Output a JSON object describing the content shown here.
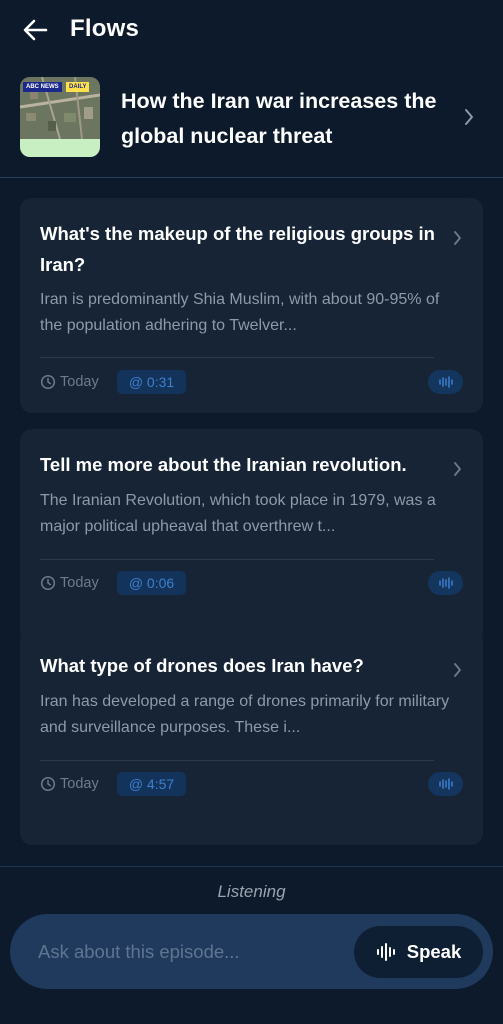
{
  "header": {
    "title": "Flows"
  },
  "episode": {
    "title": "How the Iran war increases the global nuclear threat",
    "thumbnail": {
      "brand": "ABC NEWS",
      "show": "DAILY"
    }
  },
  "cards": [
    {
      "question": "What's the makeup of the religious groups in Iran?",
      "answer": "Iran is predominantly Shia Muslim, with about 90-95% of the population adhering to Twelver...",
      "date": "Today",
      "timestamp": "@ 0:31"
    },
    {
      "question": "Tell me more about the Iranian revolution.",
      "answer": "The Iranian Revolution, which took place in 1979, was a major political upheaval that overthrew t...",
      "date": "Today",
      "timestamp": "@ 0:06"
    },
    {
      "question": "What type of drones does Iran have?",
      "answer": "Iran has developed a range of drones primarily for military and surveillance purposes. These i...",
      "date": "Today",
      "timestamp": "@ 4:57"
    }
  ],
  "footer": {
    "status": "Listening",
    "input_placeholder": "Ask about this episode...",
    "input_value": "",
    "speak_label": "Speak"
  },
  "icons": {
    "back": "arrow-left-icon",
    "chevron": "chevron-right-icon",
    "clock": "clock-icon",
    "waveform": "waveform-icon",
    "speak": "waveform-icon"
  },
  "colors": {
    "background": "#0c1a2b",
    "card": "#162436",
    "accent": "#3e7fd0",
    "input_bar": "#1f3a5c",
    "muted_text": "#8f9aa8"
  }
}
